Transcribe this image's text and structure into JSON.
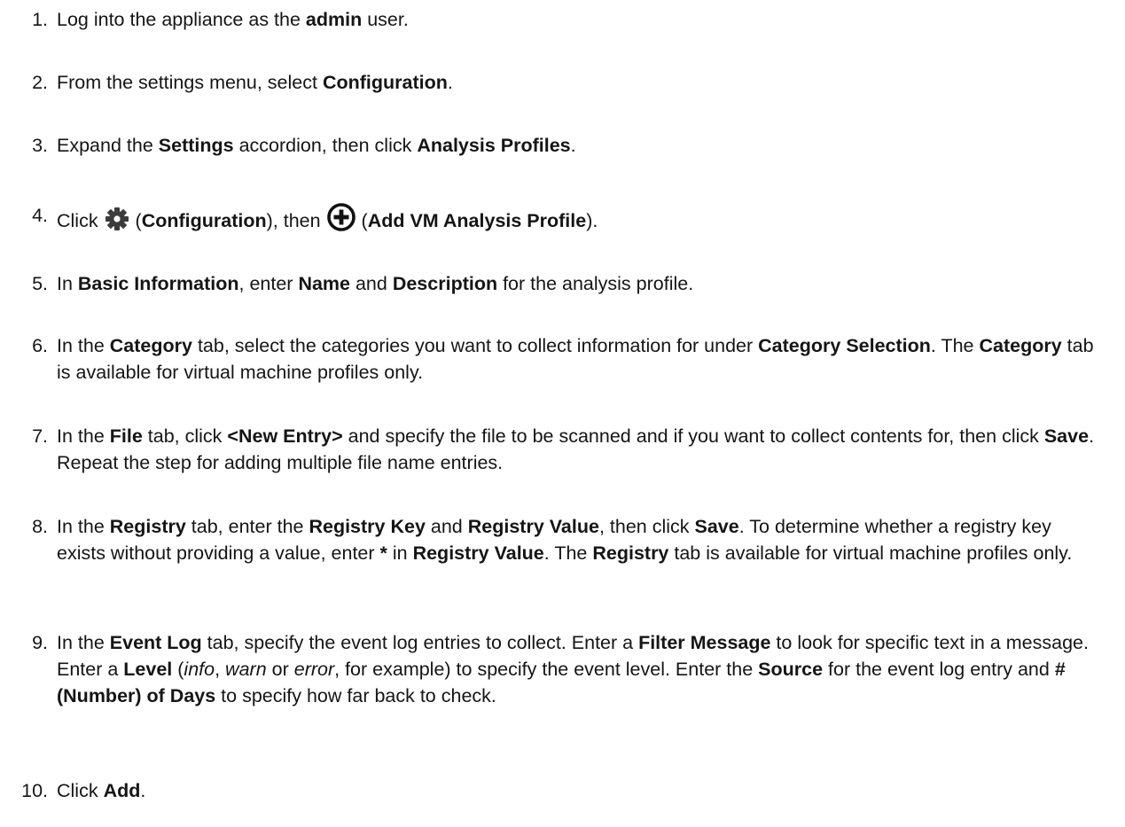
{
  "steps": [
    {
      "num": "1.",
      "parts": [
        "Log into the appliance as the ",
        "admin",
        " user."
      ]
    },
    {
      "num": "2.",
      "parts": [
        "From the settings menu, select ",
        "Configuration",
        "."
      ]
    },
    {
      "num": "3.",
      "parts": [
        "Expand the ",
        "Settings",
        " accordion, then click ",
        "Analysis Profiles",
        "."
      ]
    },
    {
      "num": "4.",
      "parts": [
        "Click ",
        " (",
        "Configuration",
        "), then ",
        " (",
        "Add VM Analysis Profile",
        ")."
      ]
    },
    {
      "num": "5.",
      "parts": [
        "In ",
        "Basic Information",
        ", enter ",
        "Name",
        " and ",
        "Description",
        " for the analysis profile."
      ]
    },
    {
      "num": "6.",
      "parts": [
        "In the ",
        "Category",
        " tab, select the categories you want to collect information for under ",
        "Category Selection",
        ". The ",
        "Category",
        " tab is available for virtual machine profiles only."
      ]
    },
    {
      "num": "7.",
      "parts": [
        "In the ",
        "File",
        " tab, click ",
        "<New Entry>",
        " and specify the file to be scanned and if you want to collect contents for, then click ",
        "Save",
        ". Repeat the step for adding multiple file name entries."
      ]
    },
    {
      "num": "8.",
      "parts": [
        "In the ",
        "Registry",
        " tab, enter the ",
        "Registry Key",
        " and ",
        "Registry Value",
        ", then click ",
        "Save",
        ". To determine whether a registry key exists without providing a value, enter ",
        "*",
        " in ",
        "Registry Value",
        ". The ",
        "Registry",
        " tab is available for virtual machine profiles only."
      ]
    },
    {
      "num": "9.",
      "parts": [
        "In the ",
        "Event Log",
        " tab, specify the event log entries to collect. Enter a ",
        "Filter Message",
        " to look for specific text in a message. Enter a ",
        "Level",
        " (",
        "info",
        ", ",
        "warn",
        " or ",
        "error",
        ", for example) to specify the event level. Enter the ",
        "Source",
        " for the event log entry and ",
        "# (Number) of Days",
        " to specify how far back to check."
      ]
    },
    {
      "num": "10.",
      "parts": [
        "Click ",
        "Add",
        "."
      ]
    }
  ],
  "icons": {
    "configuration": "gear-icon",
    "add_profile": "circle-plus-icon"
  }
}
